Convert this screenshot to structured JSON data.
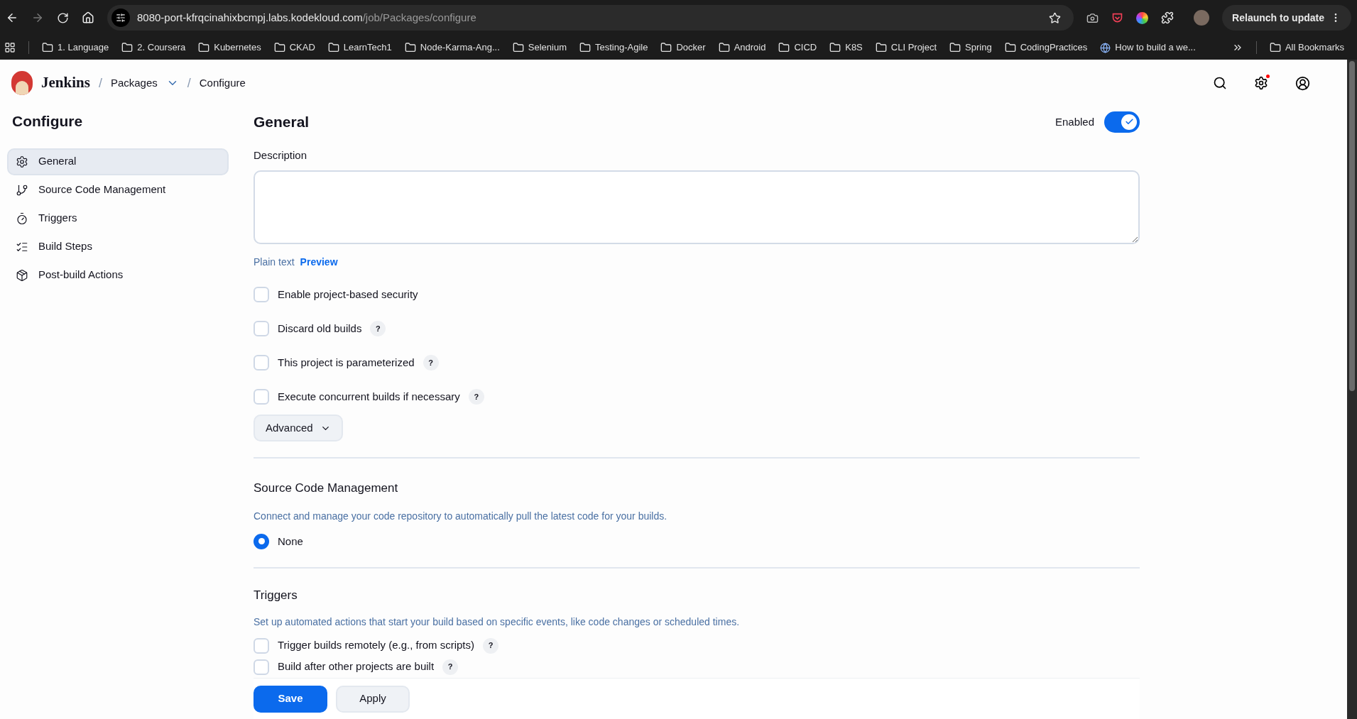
{
  "browser": {
    "url_host": "8080-port-kfrqcinahixbcmpj.labs.kodekloud.com",
    "url_path": "/job/Packages/configure",
    "relaunch": "Relaunch to update",
    "bookmarks": [
      {
        "label": "1. Language",
        "kind": "folder"
      },
      {
        "label": "2. Coursera",
        "kind": "folder"
      },
      {
        "label": "Kubernetes",
        "kind": "folder"
      },
      {
        "label": "CKAD",
        "kind": "folder"
      },
      {
        "label": "LearnTech1",
        "kind": "folder"
      },
      {
        "label": "Node-Karma-Ang...",
        "kind": "folder"
      },
      {
        "label": "Selenium",
        "kind": "folder"
      },
      {
        "label": "Testing-Agile",
        "kind": "folder"
      },
      {
        "label": "Docker",
        "kind": "folder"
      },
      {
        "label": "Android",
        "kind": "folder"
      },
      {
        "label": "CICD",
        "kind": "folder"
      },
      {
        "label": "K8S",
        "kind": "folder"
      },
      {
        "label": "CLI Project",
        "kind": "folder"
      },
      {
        "label": "Spring",
        "kind": "folder"
      },
      {
        "label": "CodingPractices",
        "kind": "folder"
      },
      {
        "label": "How to build a we...",
        "kind": "site"
      }
    ],
    "all_bookmarks": "All Bookmarks"
  },
  "header": {
    "brand": "Jenkins",
    "breadcrumbs": [
      "Packages",
      "Configure"
    ],
    "separators": [
      "/",
      "/"
    ],
    "settings_alert": true
  },
  "sidebar": {
    "title": "Configure",
    "items": [
      {
        "label": "General",
        "selected": true
      },
      {
        "label": "Source Code Management",
        "selected": false
      },
      {
        "label": "Triggers",
        "selected": false
      },
      {
        "label": "Build Steps",
        "selected": false
      },
      {
        "label": "Post-build Actions",
        "selected": false
      }
    ]
  },
  "general": {
    "title": "General",
    "enabled_label": "Enabled",
    "enabled": true,
    "description_label": "Description",
    "formats": [
      {
        "label": "Plain text",
        "kind": "text"
      },
      {
        "label": "Preview",
        "kind": "link"
      }
    ],
    "options": [
      {
        "label": "Enable project-based security",
        "checked": false
      },
      {
        "label": "Discard old builds",
        "checked": false,
        "help": "?"
      },
      {
        "label": "This project is parameterized",
        "checked": false,
        "help": "?"
      },
      {
        "label": "Execute concurrent builds if necessary",
        "checked": false,
        "help": "?"
      }
    ],
    "advanced": "Advanced"
  },
  "scm": {
    "title": "Source Code Management",
    "description": "Connect and manage your code repository to automatically pull the latest code for your builds.",
    "options": [
      {
        "label": "None",
        "selected": true
      }
    ]
  },
  "triggers": {
    "title": "Triggers",
    "description": "Set up automated actions that start your build based on specific events, like code changes or scheduled times.",
    "options": [
      {
        "label": "Trigger builds remotely (e.g., from scripts)",
        "checked": false,
        "help": "?"
      },
      {
        "label": "Build after other projects are built",
        "checked": false,
        "help": "?"
      }
    ]
  },
  "actions": [
    {
      "label": "Save",
      "kind": "primary"
    },
    {
      "label": "Apply",
      "kind": "secondary"
    }
  ]
}
